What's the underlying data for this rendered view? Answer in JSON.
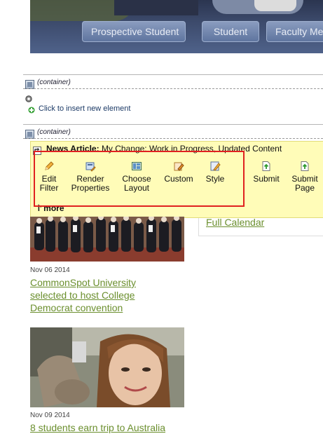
{
  "nav": {
    "buttons": [
      "Prospective Student",
      "Student",
      "Faculty Me"
    ]
  },
  "containers": [
    {
      "label": "(container)"
    },
    {
      "label": "(container)"
    }
  ],
  "insert_element": "Click to insert new element",
  "news_toolbar": {
    "type_label": "News Article:",
    "status": "My Change: Work in Progress, Updated Content",
    "tools": [
      {
        "label": "Edit Filter",
        "icon": "pencil-icon"
      },
      {
        "label": "Render Properties",
        "icon": "render-properties-icon"
      },
      {
        "label": "Choose Layout",
        "icon": "layout-icon"
      },
      {
        "label": "Custom",
        "icon": "custom-icon"
      },
      {
        "label": "Style",
        "icon": "style-icon"
      },
      {
        "label": "Submit",
        "icon": "submit-icon"
      },
      {
        "label": "Submit Page",
        "icon": "submit-page-icon"
      }
    ],
    "more_label": "more"
  },
  "calendar": {
    "link": "Full Calendar"
  },
  "articles": [
    {
      "date": "Nov 06 2014",
      "title": "CommonSpot University selected to host College Democrat convention"
    },
    {
      "date": "Nov 09 2014",
      "title": "8 students earn trip to Australia"
    }
  ],
  "colors": {
    "link": "#6b8f2e",
    "toolbar_bg": "#fffcb8",
    "highlight_border": "#e02020"
  }
}
